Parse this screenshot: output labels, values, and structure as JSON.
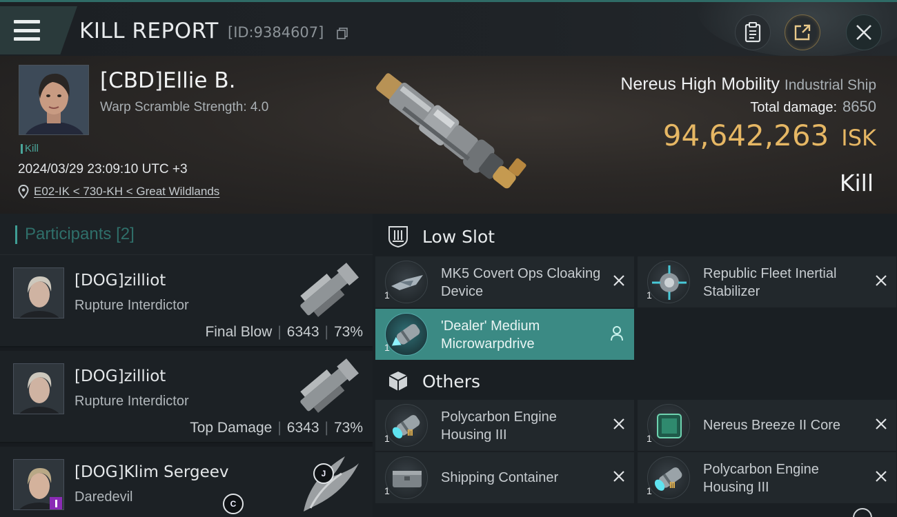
{
  "header": {
    "title": "KILL REPORT",
    "report_id": "[ID:9384607]",
    "icons": [
      "menu-icon",
      "copy-icon",
      "clipboard-icon",
      "share-icon",
      "close-icon"
    ]
  },
  "victim": {
    "name": "[CBD]Ellie B.",
    "warp_scramble": "Warp Scramble Strength: 4.0",
    "tag": "Kill",
    "datetime": "2024/03/29 23:09:10 UTC +3",
    "location": "E02-IK < 730-KH < Great Wildlands",
    "ship_name": "Nereus High Mobility",
    "ship_class": "Industrial Ship",
    "total_damage_label": "Total damage:",
    "total_damage_value": "8650",
    "isk_amount": "94,642,263",
    "isk_unit": "ISK",
    "result": "Kill"
  },
  "participants": {
    "title": "Participants",
    "count": "[2]",
    "rows": [
      {
        "name": "[DOG]zilliot",
        "ship": "Rupture Interdictor",
        "role": "Final Blow",
        "damage": "6343",
        "percent": "73%"
      },
      {
        "name": "[DOG]zilliot",
        "ship": "Rupture Interdictor",
        "role": "Top Damage",
        "damage": "6343",
        "percent": "73%"
      },
      {
        "name": "[DOG]Klim Sergeev",
        "ship": "Daredevil",
        "badge_j": "J",
        "badge_c": "C"
      }
    ]
  },
  "fittings": {
    "low_slot": {
      "title": "Low Slot",
      "items": [
        {
          "name": "MK5 Covert Ops Cloaking Device",
          "qty": "1"
        },
        {
          "name": "Republic Fleet Inertial Stabilizer",
          "qty": "1"
        },
        {
          "name": "'Dealer' Medium Microwarpdrive",
          "qty": "1"
        }
      ]
    },
    "others": {
      "title": "Others",
      "items": [
        {
          "name": "Polycarbon Engine Housing III",
          "qty": "1",
          "tier": "III"
        },
        {
          "name": "Nereus Breeze II Core",
          "qty": "1"
        },
        {
          "name": "Shipping Container",
          "qty": "1"
        },
        {
          "name": "Polycarbon Engine Housing III",
          "qty": "1",
          "tier": "III"
        }
      ]
    }
  },
  "colors": {
    "accent_teal": "#3f9e95",
    "isk_gold": "#e6b764",
    "active_item": "#3b8a84"
  }
}
